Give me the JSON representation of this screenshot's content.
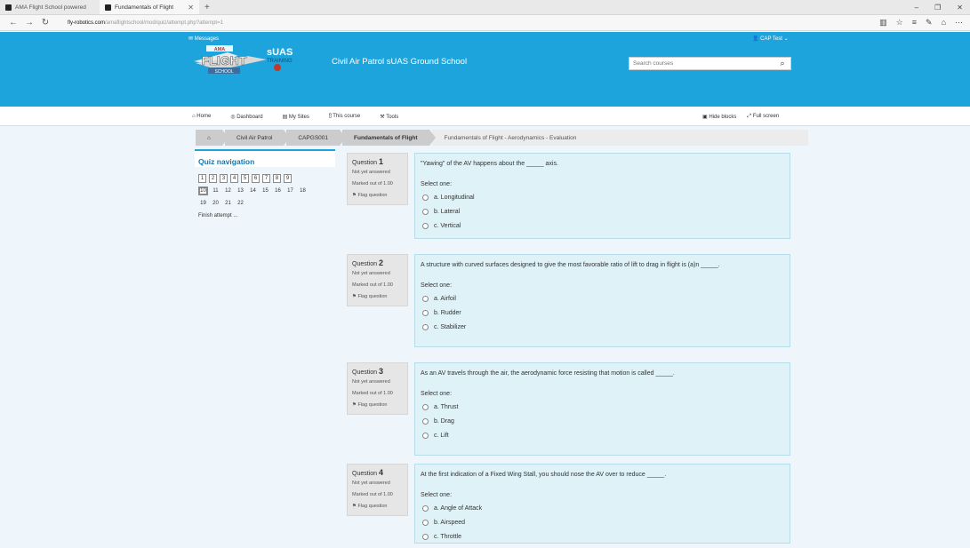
{
  "browser": {
    "tabs": [
      {
        "label": "AMA Flight School powered",
        "active": false
      },
      {
        "label": "Fundamentals of Flight",
        "active": true
      }
    ],
    "url_domain": "fly-robotics.com",
    "url_path": "/amaflightschool/mod/quiz/attempt.php?attempt=1"
  },
  "header": {
    "messages": "Messages",
    "user": "CAP Test",
    "logo_main": "FLIGHT",
    "logo_top": "AMA",
    "logo_bottom": "SCHOOL",
    "logo_suas": "sUAS",
    "logo_training": "TRAINING",
    "site_name": "Civil Air Patrol sUAS Ground School",
    "search_placeholder": "Search courses"
  },
  "topnav": {
    "items": [
      "Home",
      "Dashboard",
      "My Sites",
      "This course",
      "Tools"
    ],
    "hide_blocks": "Hide blocks",
    "full_screen": "Full screen"
  },
  "breadcrumb": [
    "Civil Air Patrol",
    "CAPGS001",
    "Fundamentals of Flight",
    "Fundamentals of Flight - Aerodynamics - Evaluation"
  ],
  "quiz_nav": {
    "title": "Quiz navigation",
    "buttons": [
      "1",
      "2",
      "3",
      "4",
      "5",
      "6",
      "7",
      "8",
      "9",
      "10",
      "11",
      "12",
      "13",
      "14",
      "15",
      "16",
      "17",
      "18",
      "19",
      "20",
      "21",
      "22"
    ],
    "current": "10",
    "finish": "Finish attempt ..."
  },
  "questions": [
    {
      "label": "Question",
      "number": "1",
      "status": "Not yet answered",
      "marks": "Marked out of 1.00",
      "flag": "Flag question",
      "text": "\"Yawing\" of the AV happens about the _____ axis.",
      "select": "Select one:",
      "options": [
        "a. Longitudinal",
        "b. Lateral",
        "c. Vertical"
      ]
    },
    {
      "label": "Question",
      "number": "2",
      "status": "Not yet answered",
      "marks": "Marked out of 1.00",
      "flag": "Flag question",
      "text": "A structure with curved surfaces designed to give the most favorable ratio of lift to drag in flight is (a)n _____.",
      "select": "Select one:",
      "options": [
        "a. Airfoil",
        "b. Rudder",
        "c. Stabilizer"
      ]
    },
    {
      "label": "Question",
      "number": "3",
      "status": "Not yet answered",
      "marks": "Marked out of 1.00",
      "flag": "Flag question",
      "text": "As an AV travels through the air, the aerodynamic force resisting that motion is called _____.",
      "select": "Select one:",
      "options": [
        "a. Thrust",
        "b. Drag",
        "c. Lift"
      ]
    },
    {
      "label": "Question",
      "number": "4",
      "status": "Not yet answered",
      "marks": "Marked out of 1.00",
      "flag": "Flag question",
      "text": "At the first indication of a Fixed Wing Stall, you should nose the AV over to reduce _____.",
      "select": "Select one:",
      "options": [
        "a. Angle of Attack",
        "b. Airspeed",
        "c. Throttle"
      ]
    }
  ]
}
